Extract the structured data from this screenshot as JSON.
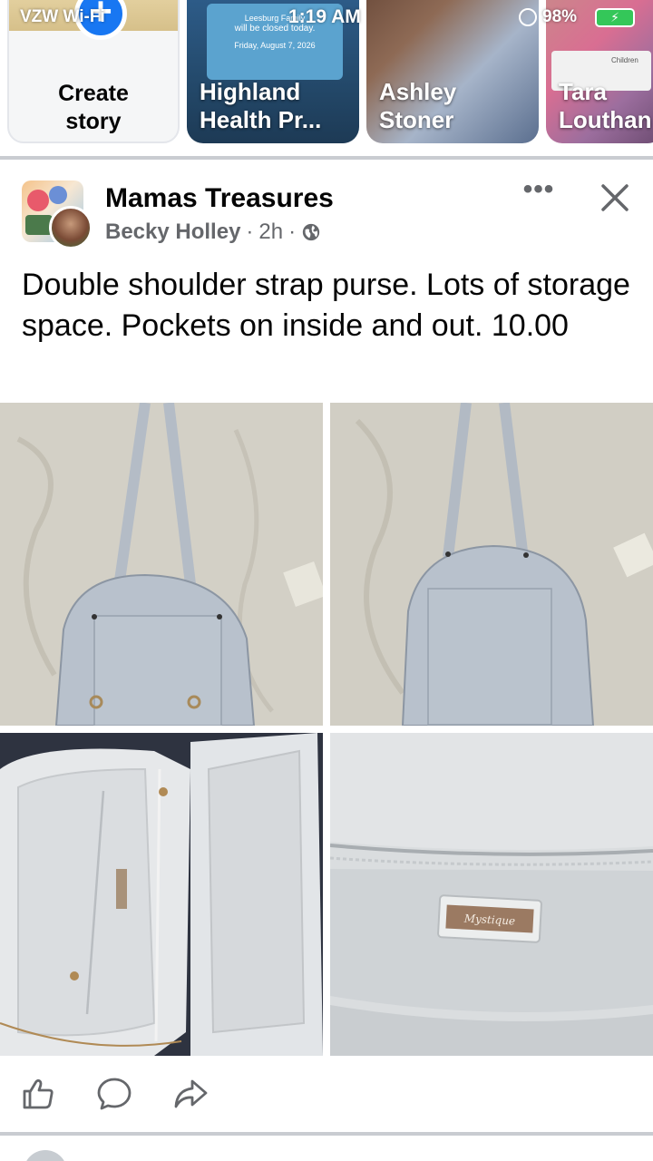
{
  "status_bar": {
    "carrier": "VZW Wi-Fi",
    "time": "1:19 AM",
    "battery": "98%"
  },
  "stories": {
    "create_label_line1": "Create",
    "create_label_line2": "story",
    "items": [
      {
        "line1": "Highland",
        "line2": "Health Pr..."
      },
      {
        "line1": "Ashley",
        "line2": "Stoner"
      },
      {
        "line1": "Tara",
        "line2": "Louthan"
      }
    ],
    "highland_card_text": [
      "Leesburg Family",
      "will be closed today.",
      "Friday, August 7, 2026"
    ],
    "tara_card_text": "Children"
  },
  "post": {
    "group_name": "Mamas Treasures",
    "author": "Becky Holley",
    "time": "2h",
    "separator": "·",
    "text": "Double shoulder strap purse. Lots of storage space. Pockets on inside and out. 10.00",
    "photo_brand": "Mystique"
  },
  "icons": {
    "plus": "plus-icon",
    "more": "more-options-icon",
    "close": "close-icon",
    "globe": "globe-icon",
    "like": "like-icon",
    "comment": "comment-icon",
    "share": "share-icon"
  },
  "colors": {
    "brand_blue": "#1877f2",
    "meta_gray": "#65676b",
    "divider": "#c9ccd1",
    "purse_gray": "#b9c2cc"
  }
}
